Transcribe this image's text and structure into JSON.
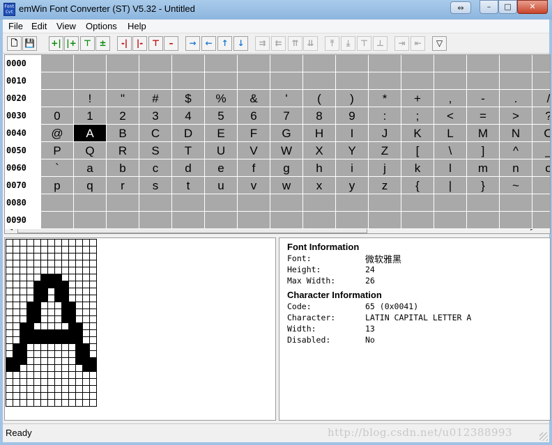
{
  "window": {
    "app_icon_text": "Font\nCvt",
    "title": "emWin Font Converter (ST) V5.32 - Untitled",
    "controls": {
      "restore_small": "⇔",
      "minimize": "–",
      "maximize": "□",
      "close": "✕"
    }
  },
  "menu": [
    "File",
    "Edit",
    "View",
    "Options",
    "Help"
  ],
  "toolbar": [
    {
      "name": "new-file",
      "glyph": "🗋",
      "color": "#000",
      "enabled": true
    },
    {
      "name": "save-file",
      "glyph": "💾",
      "color": "#000",
      "enabled": true
    },
    {
      "name": "add-column-left",
      "glyph": "+|",
      "color": "#0a8a0a",
      "enabled": true
    },
    {
      "name": "add-column-right",
      "glyph": "|+",
      "color": "#0a8a0a",
      "enabled": true
    },
    {
      "name": "add-row-top",
      "glyph": "⊤",
      "color": "#0a8a0a",
      "enabled": true
    },
    {
      "name": "add-row-bottom",
      "glyph": "±",
      "color": "#0a8a0a",
      "enabled": true
    },
    {
      "name": "remove-column-left",
      "glyph": "-|",
      "color": "#c00000",
      "enabled": true
    },
    {
      "name": "remove-column-right",
      "glyph": "|-",
      "color": "#c00000",
      "enabled": true
    },
    {
      "name": "remove-row-top",
      "glyph": "⊤",
      "color": "#c00000",
      "enabled": true
    },
    {
      "name": "remove-row-bottom",
      "glyph": "–",
      "color": "#c00000",
      "enabled": true
    },
    {
      "name": "shift-right",
      "glyph": "→",
      "color": "#1e7ad6",
      "enabled": true
    },
    {
      "name": "shift-left",
      "glyph": "←",
      "color": "#1e7ad6",
      "enabled": true
    },
    {
      "name": "shift-up",
      "glyph": "↑",
      "color": "#1e7ad6",
      "enabled": true
    },
    {
      "name": "shift-down",
      "glyph": "↓",
      "color": "#1e7ad6",
      "enabled": true
    },
    {
      "name": "shift-all-right",
      "glyph": "⇉",
      "color": "#a8a8a8",
      "enabled": false
    },
    {
      "name": "shift-all-left",
      "glyph": "⇇",
      "color": "#a8a8a8",
      "enabled": false
    },
    {
      "name": "shift-all-up",
      "glyph": "⇈",
      "color": "#a8a8a8",
      "enabled": false
    },
    {
      "name": "shift-all-down",
      "glyph": "⇊",
      "color": "#a8a8a8",
      "enabled": false
    },
    {
      "name": "align-top",
      "glyph": "⤒",
      "color": "#a8a8a8",
      "enabled": false
    },
    {
      "name": "align-bottom",
      "glyph": "⤓",
      "color": "#a8a8a8",
      "enabled": false
    },
    {
      "name": "align-top-alt",
      "glyph": "⊤",
      "color": "#a8a8a8",
      "enabled": false
    },
    {
      "name": "align-bottom-alt",
      "glyph": "⊥",
      "color": "#a8a8a8",
      "enabled": false
    },
    {
      "name": "align-right",
      "glyph": "⇥",
      "color": "#a8a8a8",
      "enabled": false
    },
    {
      "name": "align-left",
      "glyph": "⇤",
      "color": "#a8a8a8",
      "enabled": false
    },
    {
      "name": "filter",
      "glyph": "▽",
      "color": "#000",
      "enabled": true
    }
  ],
  "char_grid": {
    "rows": [
      {
        "label": "0000",
        "cells": [
          "",
          "",
          "",
          "",
          "",
          "",
          "",
          "",
          "",
          "",
          "",
          "",
          "",
          "",
          "",
          ""
        ]
      },
      {
        "label": "0010",
        "cells": [
          "",
          "",
          "",
          "",
          "",
          "",
          "",
          "",
          "",
          "",
          "",
          "",
          "",
          "",
          "",
          ""
        ]
      },
      {
        "label": "0020",
        "cells": [
          "",
          "!",
          "\"",
          "#",
          "$",
          "%",
          "&",
          "'",
          "(",
          ")",
          "*",
          "+",
          ",",
          "-",
          ".",
          "/"
        ]
      },
      {
        "label": "0030",
        "cells": [
          "0",
          "1",
          "2",
          "3",
          "4",
          "5",
          "6",
          "7",
          "8",
          "9",
          ":",
          ";",
          "<",
          "=",
          ">",
          "?"
        ]
      },
      {
        "label": "0040",
        "cells": [
          "@",
          "A",
          "B",
          "C",
          "D",
          "E",
          "F",
          "G",
          "H",
          "I",
          "J",
          "K",
          "L",
          "M",
          "N",
          "O"
        ]
      },
      {
        "label": "0050",
        "cells": [
          "P",
          "Q",
          "R",
          "S",
          "T",
          "U",
          "V",
          "W",
          "X",
          "Y",
          "Z",
          "[",
          "\\",
          "]",
          "^",
          "_"
        ]
      },
      {
        "label": "0060",
        "cells": [
          "`",
          "a",
          "b",
          "c",
          "d",
          "e",
          "f",
          "g",
          "h",
          "i",
          "j",
          "k",
          "l",
          "m",
          "n",
          "o"
        ]
      },
      {
        "label": "0070",
        "cells": [
          "p",
          "q",
          "r",
          "s",
          "t",
          "u",
          "v",
          "w",
          "x",
          "y",
          "z",
          "{",
          "|",
          "}",
          "~",
          ""
        ]
      },
      {
        "label": "0080",
        "cells": [
          "",
          "",
          "",
          "",
          "",
          "",
          "",
          "",
          "",
          "",
          "",
          "",
          "",
          "",
          "",
          ""
        ]
      },
      {
        "label": "0090",
        "cells": [
          "",
          "",
          "",
          "",
          "",
          "",
          "",
          "",
          "",
          "",
          "",
          "",
          "",
          "",
          "",
          ""
        ]
      }
    ],
    "selected": {
      "row": 4,
      "col": 1
    }
  },
  "bitmap": {
    "columns": 13,
    "pixels": [
      "0000000000000",
      "0000000000000",
      "0000000000000",
      "0000000000000",
      "0000000000000",
      "0000011100000",
      "0000111110000",
      "0000110110000",
      "0000110110000",
      "0001100011000",
      "0001100011000",
      "0001100011000",
      "0011000001100",
      "0011111111100",
      "0011111111100",
      "0110000000110",
      "0110000000110",
      "1110000000111",
      "1100000000011",
      "0000000000000",
      "0000000000000",
      "0000000000000",
      "0000000000000",
      "0000000000000"
    ]
  },
  "info": {
    "font_section": {
      "title": "Font Information",
      "rows": [
        {
          "label": "Font:",
          "value": "微软雅黑"
        },
        {
          "label": "Height:",
          "value": "24"
        },
        {
          "label": "Max Width:",
          "value": "26"
        }
      ]
    },
    "char_section": {
      "title": "Character Information",
      "rows": [
        {
          "label": "Code:",
          "value": "65 (0x0041)"
        },
        {
          "label": "Character:",
          "value": "LATIN CAPITAL LETTER A"
        },
        {
          "label": "Width:",
          "value": "13"
        },
        {
          "label": "Disabled:",
          "value": "No"
        }
      ]
    }
  },
  "status": {
    "text": "Ready",
    "watermark": "http://blog.csdn.net/u012388993"
  }
}
